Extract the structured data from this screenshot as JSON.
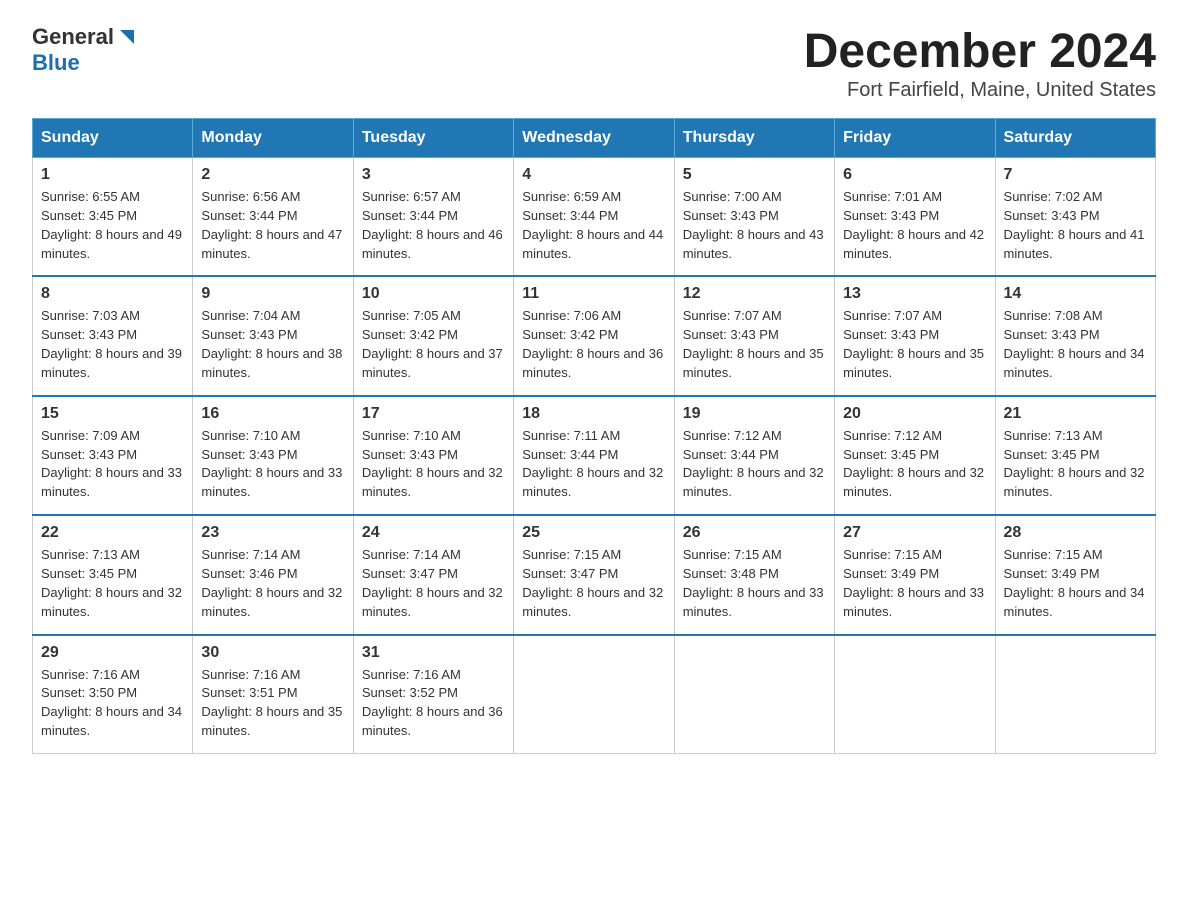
{
  "logo": {
    "general": "General",
    "blue": "Blue"
  },
  "title": "December 2024",
  "subtitle": "Fort Fairfield, Maine, United States",
  "weekdays": [
    "Sunday",
    "Monday",
    "Tuesday",
    "Wednesday",
    "Thursday",
    "Friday",
    "Saturday"
  ],
  "weeks": [
    [
      {
        "day": "1",
        "sunrise": "Sunrise: 6:55 AM",
        "sunset": "Sunset: 3:45 PM",
        "daylight": "Daylight: 8 hours and 49 minutes."
      },
      {
        "day": "2",
        "sunrise": "Sunrise: 6:56 AM",
        "sunset": "Sunset: 3:44 PM",
        "daylight": "Daylight: 8 hours and 47 minutes."
      },
      {
        "day": "3",
        "sunrise": "Sunrise: 6:57 AM",
        "sunset": "Sunset: 3:44 PM",
        "daylight": "Daylight: 8 hours and 46 minutes."
      },
      {
        "day": "4",
        "sunrise": "Sunrise: 6:59 AM",
        "sunset": "Sunset: 3:44 PM",
        "daylight": "Daylight: 8 hours and 44 minutes."
      },
      {
        "day": "5",
        "sunrise": "Sunrise: 7:00 AM",
        "sunset": "Sunset: 3:43 PM",
        "daylight": "Daylight: 8 hours and 43 minutes."
      },
      {
        "day": "6",
        "sunrise": "Sunrise: 7:01 AM",
        "sunset": "Sunset: 3:43 PM",
        "daylight": "Daylight: 8 hours and 42 minutes."
      },
      {
        "day": "7",
        "sunrise": "Sunrise: 7:02 AM",
        "sunset": "Sunset: 3:43 PM",
        "daylight": "Daylight: 8 hours and 41 minutes."
      }
    ],
    [
      {
        "day": "8",
        "sunrise": "Sunrise: 7:03 AM",
        "sunset": "Sunset: 3:43 PM",
        "daylight": "Daylight: 8 hours and 39 minutes."
      },
      {
        "day": "9",
        "sunrise": "Sunrise: 7:04 AM",
        "sunset": "Sunset: 3:43 PM",
        "daylight": "Daylight: 8 hours and 38 minutes."
      },
      {
        "day": "10",
        "sunrise": "Sunrise: 7:05 AM",
        "sunset": "Sunset: 3:42 PM",
        "daylight": "Daylight: 8 hours and 37 minutes."
      },
      {
        "day": "11",
        "sunrise": "Sunrise: 7:06 AM",
        "sunset": "Sunset: 3:42 PM",
        "daylight": "Daylight: 8 hours and 36 minutes."
      },
      {
        "day": "12",
        "sunrise": "Sunrise: 7:07 AM",
        "sunset": "Sunset: 3:43 PM",
        "daylight": "Daylight: 8 hours and 35 minutes."
      },
      {
        "day": "13",
        "sunrise": "Sunrise: 7:07 AM",
        "sunset": "Sunset: 3:43 PM",
        "daylight": "Daylight: 8 hours and 35 minutes."
      },
      {
        "day": "14",
        "sunrise": "Sunrise: 7:08 AM",
        "sunset": "Sunset: 3:43 PM",
        "daylight": "Daylight: 8 hours and 34 minutes."
      }
    ],
    [
      {
        "day": "15",
        "sunrise": "Sunrise: 7:09 AM",
        "sunset": "Sunset: 3:43 PM",
        "daylight": "Daylight: 8 hours and 33 minutes."
      },
      {
        "day": "16",
        "sunrise": "Sunrise: 7:10 AM",
        "sunset": "Sunset: 3:43 PM",
        "daylight": "Daylight: 8 hours and 33 minutes."
      },
      {
        "day": "17",
        "sunrise": "Sunrise: 7:10 AM",
        "sunset": "Sunset: 3:43 PM",
        "daylight": "Daylight: 8 hours and 32 minutes."
      },
      {
        "day": "18",
        "sunrise": "Sunrise: 7:11 AM",
        "sunset": "Sunset: 3:44 PM",
        "daylight": "Daylight: 8 hours and 32 minutes."
      },
      {
        "day": "19",
        "sunrise": "Sunrise: 7:12 AM",
        "sunset": "Sunset: 3:44 PM",
        "daylight": "Daylight: 8 hours and 32 minutes."
      },
      {
        "day": "20",
        "sunrise": "Sunrise: 7:12 AM",
        "sunset": "Sunset: 3:45 PM",
        "daylight": "Daylight: 8 hours and 32 minutes."
      },
      {
        "day": "21",
        "sunrise": "Sunrise: 7:13 AM",
        "sunset": "Sunset: 3:45 PM",
        "daylight": "Daylight: 8 hours and 32 minutes."
      }
    ],
    [
      {
        "day": "22",
        "sunrise": "Sunrise: 7:13 AM",
        "sunset": "Sunset: 3:45 PM",
        "daylight": "Daylight: 8 hours and 32 minutes."
      },
      {
        "day": "23",
        "sunrise": "Sunrise: 7:14 AM",
        "sunset": "Sunset: 3:46 PM",
        "daylight": "Daylight: 8 hours and 32 minutes."
      },
      {
        "day": "24",
        "sunrise": "Sunrise: 7:14 AM",
        "sunset": "Sunset: 3:47 PM",
        "daylight": "Daylight: 8 hours and 32 minutes."
      },
      {
        "day": "25",
        "sunrise": "Sunrise: 7:15 AM",
        "sunset": "Sunset: 3:47 PM",
        "daylight": "Daylight: 8 hours and 32 minutes."
      },
      {
        "day": "26",
        "sunrise": "Sunrise: 7:15 AM",
        "sunset": "Sunset: 3:48 PM",
        "daylight": "Daylight: 8 hours and 33 minutes."
      },
      {
        "day": "27",
        "sunrise": "Sunrise: 7:15 AM",
        "sunset": "Sunset: 3:49 PM",
        "daylight": "Daylight: 8 hours and 33 minutes."
      },
      {
        "day": "28",
        "sunrise": "Sunrise: 7:15 AM",
        "sunset": "Sunset: 3:49 PM",
        "daylight": "Daylight: 8 hours and 34 minutes."
      }
    ],
    [
      {
        "day": "29",
        "sunrise": "Sunrise: 7:16 AM",
        "sunset": "Sunset: 3:50 PM",
        "daylight": "Daylight: 8 hours and 34 minutes."
      },
      {
        "day": "30",
        "sunrise": "Sunrise: 7:16 AM",
        "sunset": "Sunset: 3:51 PM",
        "daylight": "Daylight: 8 hours and 35 minutes."
      },
      {
        "day": "31",
        "sunrise": "Sunrise: 7:16 AM",
        "sunset": "Sunset: 3:52 PM",
        "daylight": "Daylight: 8 hours and 36 minutes."
      },
      null,
      null,
      null,
      null
    ]
  ]
}
